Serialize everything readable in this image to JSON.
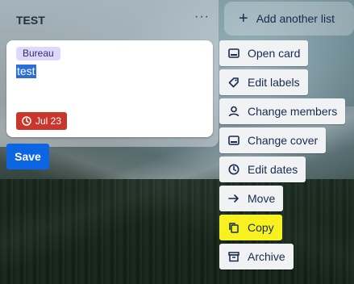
{
  "list": {
    "title": "TEST",
    "menu_glyph": "···",
    "add_list_label": "Add another list"
  },
  "card": {
    "label": "Bureau",
    "label_color": "#dfd8fd",
    "text": "test",
    "due": "Jul 23",
    "due_color": "#c9372c",
    "save_label": "Save"
  },
  "actions": [
    {
      "label": "Open card",
      "icon": "card-icon"
    },
    {
      "label": "Edit labels",
      "icon": "tag-icon"
    },
    {
      "label": "Change members",
      "icon": "person-icon"
    },
    {
      "label": "Change cover",
      "icon": "cover-icon"
    },
    {
      "label": "Edit dates",
      "icon": "clock-icon"
    },
    {
      "label": "Move",
      "icon": "arrow-right-icon"
    },
    {
      "label": "Copy",
      "icon": "copy-icon",
      "highlighted": true
    },
    {
      "label": "Archive",
      "icon": "archive-icon"
    }
  ],
  "colors": {
    "accent": "#0c66e4",
    "highlight": "#f7f11f"
  }
}
